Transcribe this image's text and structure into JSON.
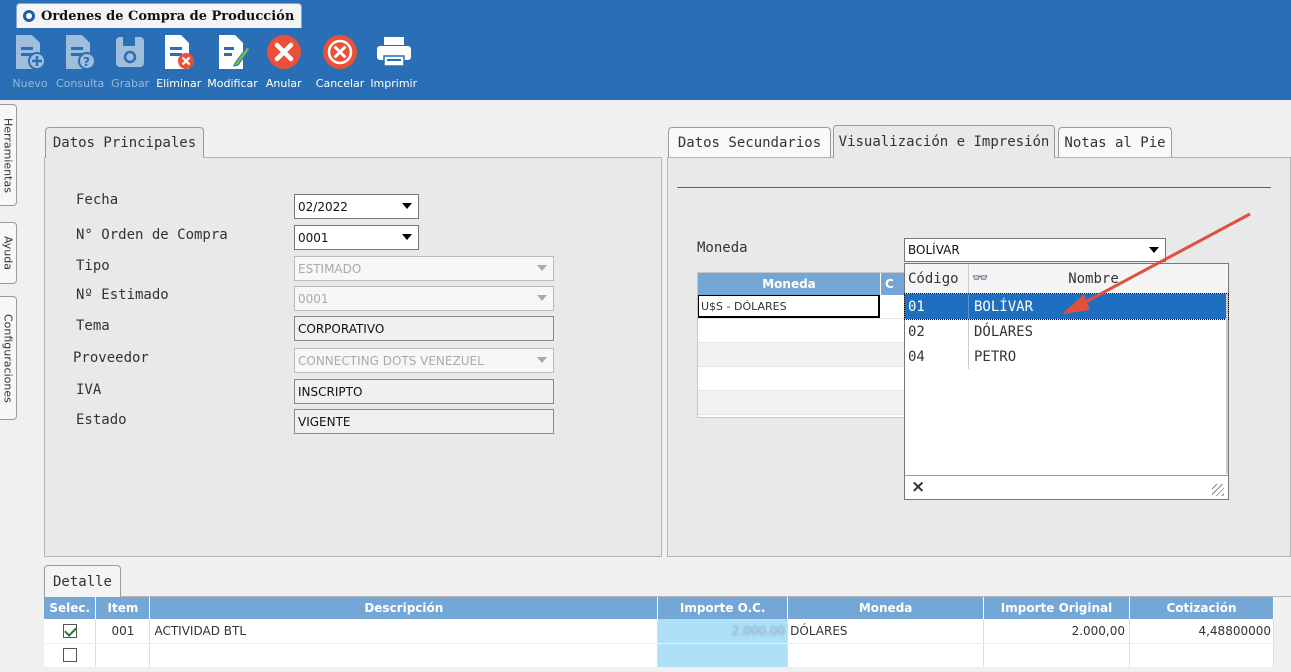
{
  "window": {
    "title": "Ordenes de Compra de Producción"
  },
  "toolbar": {
    "buttons": [
      {
        "label": "Nuevo",
        "icon": "new-doc-icon",
        "enabled": false
      },
      {
        "label": "Consulta",
        "icon": "query-doc-icon",
        "enabled": false
      },
      {
        "label": "Grabar",
        "icon": "save-icon",
        "enabled": false
      },
      {
        "label": "Eliminar",
        "icon": "delete-doc-icon",
        "enabled": true
      },
      {
        "label": "Modificar",
        "icon": "edit-doc-icon",
        "enabled": true
      },
      {
        "label": "Anular",
        "icon": "void-icon",
        "enabled": true
      },
      {
        "label": "Cancelar",
        "icon": "cancel-icon",
        "enabled": true
      },
      {
        "label": "Imprimir",
        "icon": "printer-icon",
        "enabled": true
      }
    ]
  },
  "sidetabs": [
    "Herramientas",
    "Ayuda",
    "Configuraciones"
  ],
  "main_panel": {
    "tab": "Datos Principales",
    "fields": [
      {
        "label": "Fecha",
        "value": "02/2022"
      },
      {
        "label": "N° Orden de Compra",
        "value": "0001"
      },
      {
        "label": "Tipo",
        "value": "ESTIMADO"
      },
      {
        "label": "Nº Estimado",
        "value": "0001"
      },
      {
        "label": "Tema",
        "value": "CORPORATIVO"
      },
      {
        "label": "Proveedor",
        "value": "CONNECTING DOTS VENEZUEL"
      },
      {
        "label": "IVA",
        "value": "INSCRIPTO"
      },
      {
        "label": "Estado",
        "value": "VIGENTE"
      }
    ]
  },
  "right_panel": {
    "tabs": [
      "Datos Secundarios",
      "Visualización e Impresión",
      "Notas al Pie"
    ],
    "active_tab": "Visualización e Impresión",
    "moneda_label": "Moneda",
    "moneda_value": "BOLÍVAR",
    "grid": {
      "headers": [
        "Moneda",
        "C"
      ],
      "rows": [
        [
          "U$S - DÓLARES",
          ""
        ]
      ]
    },
    "dropdown": {
      "headers": {
        "code": "Código",
        "name": "Nombre"
      },
      "items": [
        {
          "code": "01",
          "name": "BOLÍVAR",
          "selected": true
        },
        {
          "code": "02",
          "name": "DÓLARES",
          "selected": false
        },
        {
          "code": "04",
          "name": "PETRO",
          "selected": false
        }
      ],
      "close": "×"
    }
  },
  "detail": {
    "tab": "Detalle",
    "headers": [
      "Selec.",
      "Item",
      "Descripción",
      "Importe O.C.",
      "Moneda",
      "Importe Original",
      "Cotización"
    ],
    "rows": [
      {
        "checked": true,
        "item": "001",
        "descripcion": "ACTIVIDAD BTL",
        "importe_oc": "2.000,00",
        "moneda": "DÓLARES",
        "importe_original": "2.000,00",
        "cotizacion": "4,48800000"
      },
      {
        "checked": false,
        "item": "",
        "descripcion": "",
        "importe_oc": "",
        "moneda": "",
        "importe_original": "",
        "cotizacion": ""
      }
    ]
  },
  "colors": {
    "toolbar_bg": "#2a6fb5",
    "grid_header": "#74a7d6",
    "selection": "#1e6fc0",
    "annotation_arrow": "#e0503c"
  }
}
